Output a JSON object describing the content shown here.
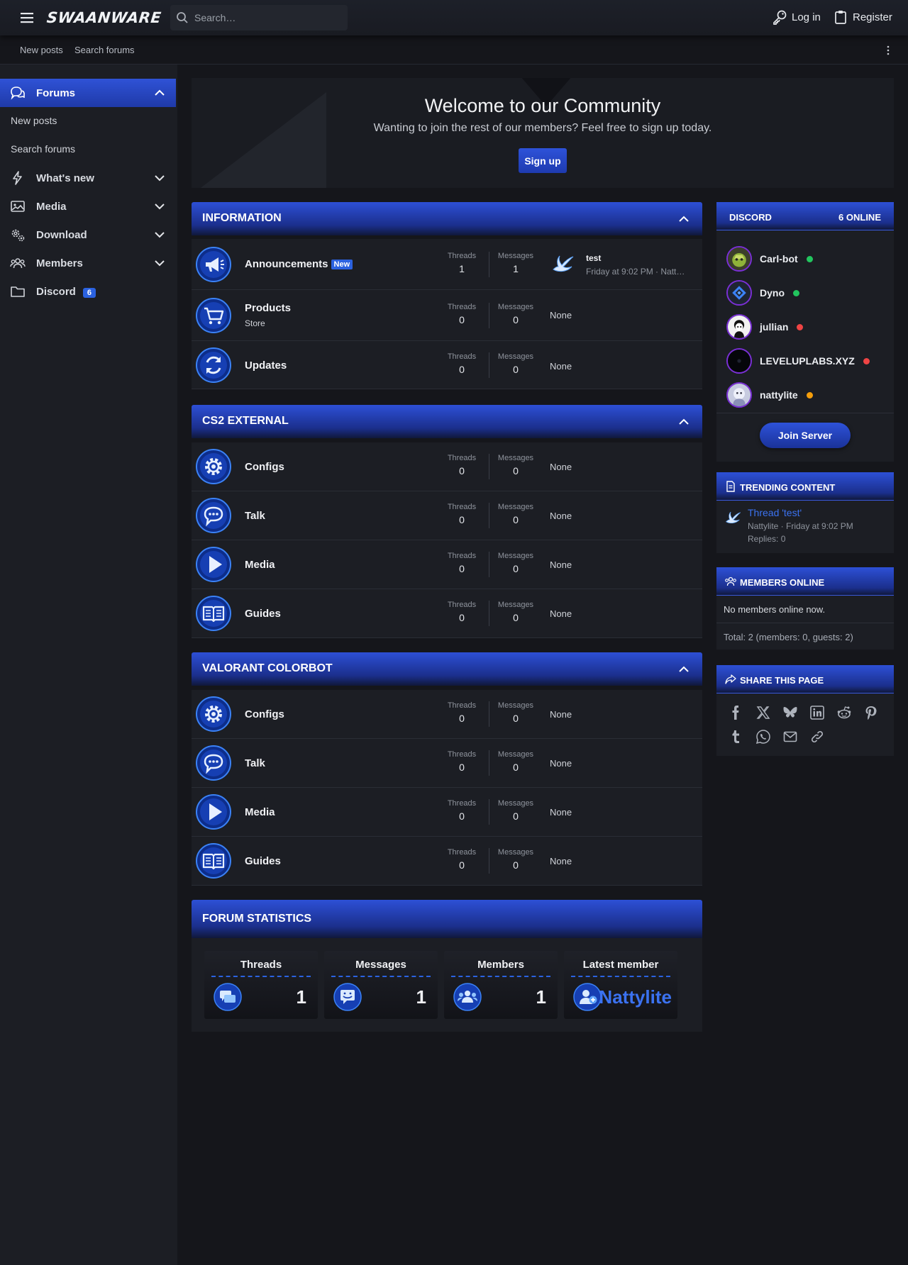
{
  "header": {
    "logo": "SWAANWARE",
    "search_placeholder": "Search…",
    "login": "Log in",
    "register": "Register"
  },
  "subnav": {
    "new_posts": "New posts",
    "search_forums": "Search forums"
  },
  "sidebar": {
    "forums": "Forums",
    "new_posts": "New posts",
    "search_forums": "Search forums",
    "whats_new": "What's new",
    "media": "Media",
    "download": "Download",
    "members": "Members",
    "discord": "Discord",
    "discord_count": "6"
  },
  "welcome": {
    "title": "Welcome to our Community",
    "subtitle": "Wanting to join the rest of our members? Feel free to sign up today.",
    "signup": "Sign up"
  },
  "labels": {
    "threads": "Threads",
    "messages": "Messages",
    "none": "None",
    "new": "New"
  },
  "categories": [
    {
      "title": "INFORMATION",
      "nodes": [
        {
          "title": "Announcements",
          "threads": "1",
          "messages": "1",
          "latest_title": "test",
          "latest_meta": "Friday at 9:02 PM · Natt…"
        },
        {
          "title": "Products",
          "desc": "Store",
          "threads": "0",
          "messages": "0"
        },
        {
          "title": "Updates",
          "threads": "0",
          "messages": "0"
        }
      ]
    },
    {
      "title": "CS2 EXTERNAL",
      "nodes": [
        {
          "title": "Configs",
          "threads": "0",
          "messages": "0"
        },
        {
          "title": "Talk",
          "threads": "0",
          "messages": "0"
        },
        {
          "title": "Media",
          "threads": "0",
          "messages": "0"
        },
        {
          "title": "Guides",
          "threads": "0",
          "messages": "0"
        }
      ]
    },
    {
      "title": "VALORANT COLORBOT",
      "nodes": [
        {
          "title": "Configs",
          "threads": "0",
          "messages": "0"
        },
        {
          "title": "Talk",
          "threads": "0",
          "messages": "0"
        },
        {
          "title": "Media",
          "threads": "0",
          "messages": "0"
        },
        {
          "title": "Guides",
          "threads": "0",
          "messages": "0"
        }
      ]
    }
  ],
  "discord": {
    "title": "DISCORD",
    "online": "6 ONLINE",
    "members": [
      {
        "name": "Carl-bot",
        "status": "#22c55e"
      },
      {
        "name": "Dyno",
        "status": "#22c55e"
      },
      {
        "name": "jullian",
        "status": "#ef4444"
      },
      {
        "name": "LEVELUPLABS.XYZ",
        "status": "#ef4444"
      },
      {
        "name": "nattylite",
        "status": "#f59e0b"
      }
    ],
    "join": "Join Server"
  },
  "trending": {
    "title": "TRENDING CONTENT",
    "item_title": "Thread 'test'",
    "item_meta": "Nattylite · Friday at 9:02 PM",
    "item_replies": "Replies: 0"
  },
  "members_online": {
    "title": "MEMBERS ONLINE",
    "text": "No members online now.",
    "total": "Total: 2 (members: 0, guests: 2)"
  },
  "share": {
    "title": "SHARE THIS PAGE"
  },
  "forum_stats": {
    "title": "FORUM STATISTICS",
    "threads_label": "Threads",
    "threads": "1",
    "messages_label": "Messages",
    "messages": "1",
    "members_label": "Members",
    "members": "1",
    "latest_label": "Latest member",
    "latest": "Nattylite"
  },
  "colors": {
    "accent": "#2b62e0",
    "bg": "#15161b",
    "panel": "#1c1e24"
  }
}
